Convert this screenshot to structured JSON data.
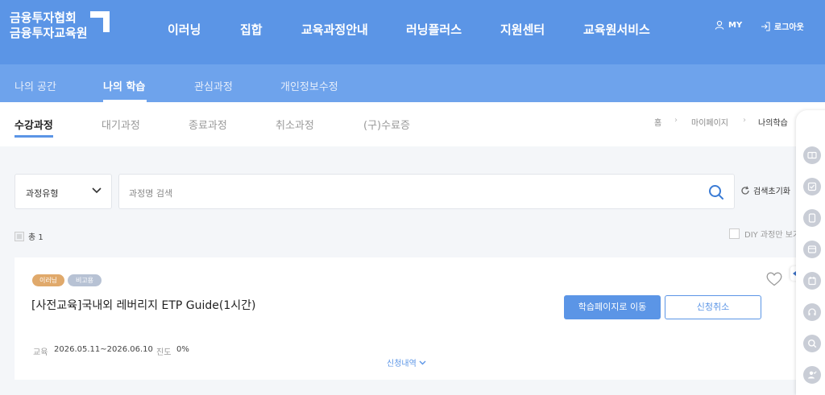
{
  "header": {
    "logo_line1": "금융투자협회",
    "logo_line2": "금융투자교육원",
    "nav": [
      "이러닝",
      "집합",
      "교육과정안내",
      "러닝플러스",
      "지원센터",
      "교육원서비스"
    ],
    "my_label": "MY",
    "logout_label": "로그아웃"
  },
  "subnav": {
    "items": [
      "나의 공간",
      "나의 학습",
      "관심과정",
      "개인정보수정"
    ],
    "active": "나의 학습"
  },
  "tabs": {
    "items": [
      "수강과정",
      "대기과정",
      "종료과정",
      "취소과정",
      "(구)수료증"
    ],
    "active": "수강과정"
  },
  "breadcrumb": [
    "홈",
    "마이페이지",
    "나의학습"
  ],
  "filter": {
    "select_value": "과정유형",
    "search_placeholder": "과정명 검색",
    "reset_label": "검색초기화",
    "total_label": "총 1",
    "diy_label": "DIY 과정만 보기"
  },
  "course": {
    "badges": [
      {
        "label": "이러닝",
        "color": "#e0a96b"
      },
      {
        "label": "비고용",
        "color": "#b7c2d4"
      }
    ],
    "title": "[사전교육]국내외 레버리지 ETP Guide(1시간)",
    "primary_button": "학습페이지로 이동",
    "secondary_button": "신청취소",
    "period_label": "교육",
    "period_value": "2026.05.11~2026.06.10",
    "progress_label": "진도",
    "progress_value": "0%",
    "details_label": "신청내역"
  },
  "colors": {
    "brand": "#5b95e6",
    "subnav": "#6ea3ec"
  },
  "quick_menu_icons": [
    "book-icon",
    "checklist-icon",
    "tablet-icon",
    "archive-icon",
    "calendar-icon",
    "headset-icon",
    "search-icon",
    "user-check-icon"
  ]
}
